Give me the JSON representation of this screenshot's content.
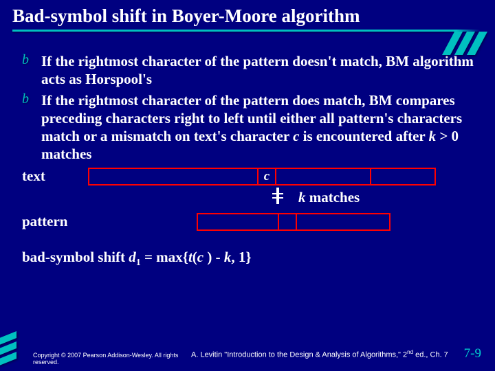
{
  "title": "Bad-symbol shift in Boyer-Moore algorithm",
  "bullets": [
    "If the rightmost character of the pattern doesn't match, BM algorithm acts as Horspool's",
    "If the rightmost character of the pattern does match, BM compares preceding characters right to left until either all pattern's characters match or a mismatch on text's character "
  ],
  "bullet2_tail_c": "c",
  "bullet2_tail_mid": " is encountered after ",
  "bullet2_tail_k": "k",
  "bullet2_tail_end": " > 0 matches",
  "labels": {
    "text": "text",
    "pattern": "pattern",
    "c": "c",
    "k": "k",
    "matches": " matches"
  },
  "formula": {
    "prefix": "bad-symbol shift ",
    "d": "d",
    "sub1": "1",
    "mid": " = max{",
    "t": "t",
    "open": "(",
    "c": "c",
    "close": " ) - ",
    "k": "k",
    "end": ", 1}"
  },
  "footer": {
    "copyright": "Copyright © 2007 Pearson Addison-Wesley. All rights reserved.",
    "citation_pre": "A. Levitin \"Introduction to the Design & Analysis of Algorithms,\" 2",
    "citation_sup": "nd",
    "citation_post": " ed., Ch. 7",
    "page": "7-9"
  },
  "bullet_glyph": "b"
}
